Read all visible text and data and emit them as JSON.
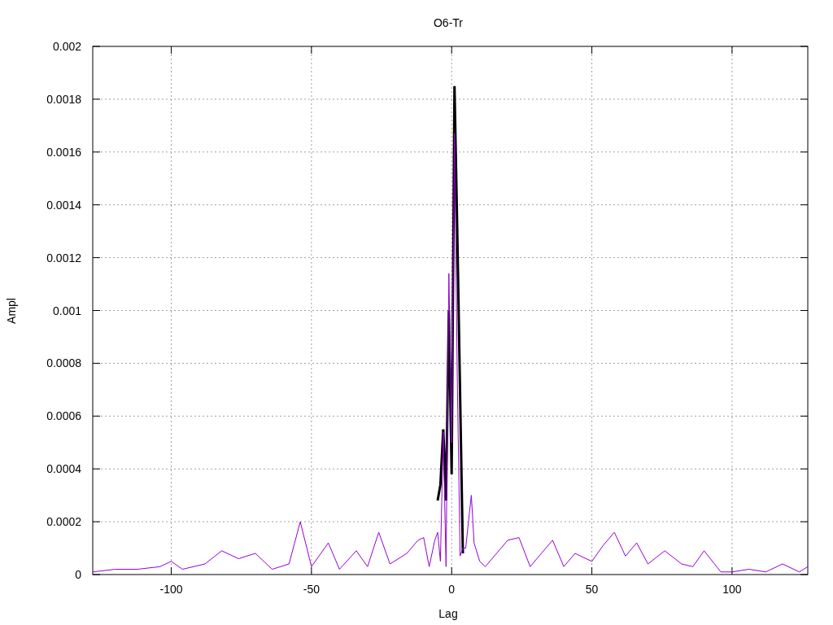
{
  "chart": {
    "chart_data": {
      "type": "line",
      "grid": true,
      "title": "O6-Tr",
      "xlabel": "Lag",
      "ylabel": "Ampl",
      "xlim": [
        -128,
        127
      ],
      "ylim": [
        0,
        0.002
      ],
      "xticks": [
        -100,
        -50,
        0,
        50,
        100
      ],
      "yticks": [
        0,
        0.0002,
        0.0004,
        0.0006,
        0.0008,
        0.001,
        0.0012,
        0.0014,
        0.0016,
        0.0018,
        0.002
      ],
      "x": [
        -128,
        -120,
        -112,
        -104,
        -100,
        -96,
        -88,
        -82,
        -76,
        -70,
        -64,
        -58,
        -54,
        -50,
        -44,
        -40,
        -34,
        -30,
        -26,
        -22,
        -16,
        -12,
        -10,
        -8,
        -6,
        -5,
        -4,
        -3,
        -2,
        -1,
        0,
        1,
        2,
        3,
        4,
        5,
        6,
        7,
        8,
        10,
        12,
        16,
        20,
        24,
        28,
        32,
        36,
        40,
        44,
        50,
        54,
        58,
        62,
        66,
        70,
        76,
        82,
        86,
        90,
        96,
        100,
        106,
        112,
        118,
        124,
        127
      ],
      "series": [
        {
          "color": "#000000",
          "values": [
            null,
            null,
            null,
            null,
            null,
            null,
            null,
            null,
            null,
            null,
            null,
            null,
            null,
            null,
            null,
            null,
            null,
            null,
            null,
            null,
            null,
            null,
            null,
            null,
            null,
            0.00028,
            0.00034,
            0.00055,
            0.00028,
            0.001,
            0.00038,
            0.00185,
            0.0013,
            0.00068,
            8e-05,
            null,
            null,
            null,
            null,
            null,
            null,
            null,
            null,
            null,
            null,
            null,
            null,
            null,
            null,
            null,
            null,
            null,
            null,
            null,
            null,
            null,
            null,
            null,
            null,
            null,
            null,
            null,
            null,
            null,
            null,
            null
          ]
        },
        {
          "color": "#9400d3",
          "values": [
            1e-05,
            2e-05,
            2e-05,
            3e-05,
            5e-05,
            2e-05,
            4e-05,
            9e-05,
            6e-05,
            8e-05,
            2e-05,
            4e-05,
            0.0002,
            3e-05,
            0.00012,
            2e-05,
            9e-05,
            3e-05,
            0.00016,
            4e-05,
            8e-05,
            0.00013,
            0.00014,
            3e-05,
            0.00013,
            0.00016,
            5e-05,
            0.00054,
            3e-05,
            0.00114,
            0.0005,
            0.00167,
            0.00075,
            7e-05,
            0.0001,
            0.0001,
            0.0002,
            0.0003,
            0.00012,
            5e-05,
            3e-05,
            8e-05,
            0.00013,
            0.00014,
            3e-05,
            8e-05,
            0.00013,
            3e-05,
            8e-05,
            5e-05,
            0.00011,
            0.00016,
            7e-05,
            0.00012,
            4e-05,
            9e-05,
            4e-05,
            3e-05,
            9e-05,
            1e-05,
            1e-05,
            2e-05,
            1e-05,
            4e-05,
            1e-05,
            3e-05
          ]
        }
      ]
    }
  }
}
